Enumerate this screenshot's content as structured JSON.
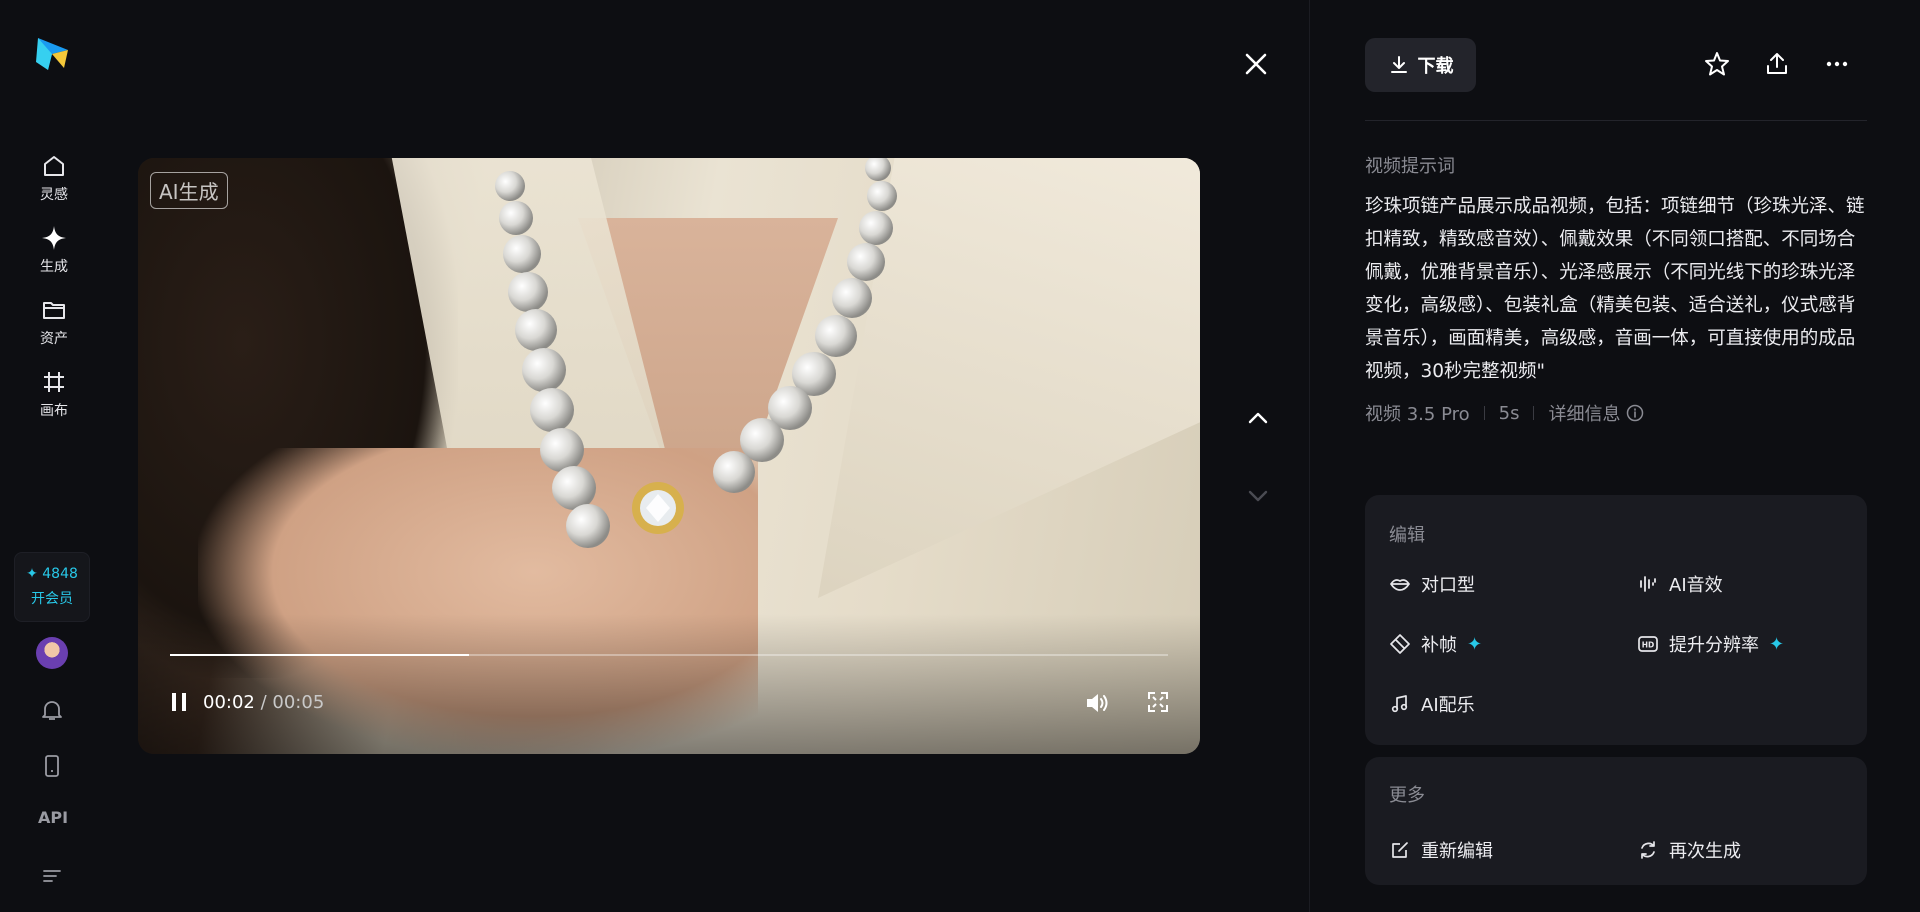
{
  "sidebar": {
    "items": [
      {
        "label": "灵感",
        "icon": "home-icon"
      },
      {
        "label": "生成",
        "icon": "sparkle-icon"
      },
      {
        "label": "资产",
        "icon": "folder-icon"
      },
      {
        "label": "画布",
        "icon": "canvas-icon"
      }
    ],
    "credits": "✦ 4848",
    "vip_label": "开会员",
    "api_label": "API"
  },
  "video": {
    "badge": "AI生成",
    "current_time": "00:02",
    "total_time": "/ 00:05",
    "progress": 0.3
  },
  "toolbar": {
    "download_label": "下载"
  },
  "prompt": {
    "title": "视频提示词",
    "text": "珍珠项链产品展示成品视频，包括：项链细节（珍珠光泽、链扣精致，精致感音效）、佩戴效果（不同领口搭配、不同场合佩戴，优雅背景音乐）、光泽感展示（不同光线下的珍珠光泽变化，高级感）、包装礼盒（精美包装、适合送礼，仪式感背景音乐），画面精美，高级感，音画一体，可直接使用的成品视频，30秒完整视频\""
  },
  "meta": {
    "model": "视频 3.5 Pro",
    "duration": "5s",
    "details": "详细信息"
  },
  "edit_card": {
    "title": "编辑",
    "actions": [
      {
        "label": "对口型",
        "icon": "lips-icon"
      },
      {
        "label": "AI音效",
        "icon": "audio-wave-icon"
      },
      {
        "label": "补帧",
        "icon": "frame-icon",
        "premium": true
      },
      {
        "label": "提升分辨率",
        "icon": "hd-icon",
        "premium": true
      },
      {
        "label": "AI配乐",
        "icon": "music-note-icon"
      }
    ]
  },
  "more_card": {
    "title": "更多",
    "actions": [
      {
        "label": "重新编辑",
        "icon": "edit-icon"
      },
      {
        "label": "再次生成",
        "icon": "regenerate-icon"
      }
    ]
  },
  "colors": {
    "background": "#0d0e12",
    "card": "#1a1b21",
    "accent": "#28c8e8"
  }
}
